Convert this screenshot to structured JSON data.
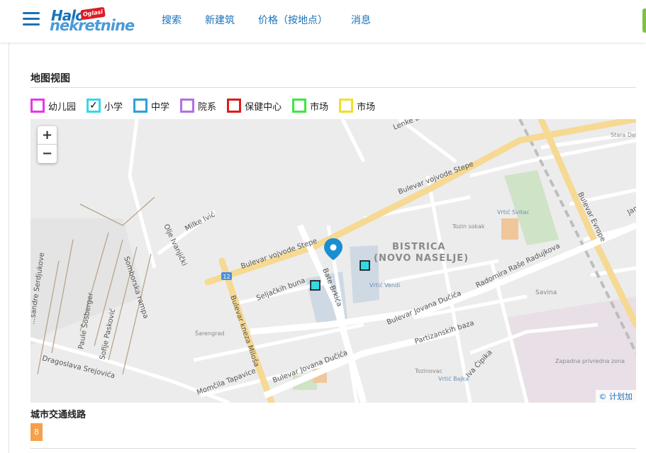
{
  "header": {
    "logo_top": "Halo",
    "logo_badge": "Oglasi",
    "logo_bottom": "nekretnine",
    "nav": [
      "搜索",
      "新建筑",
      "价格（按地点）",
      "消息"
    ]
  },
  "map_section": {
    "title": "地图视图",
    "legend": [
      {
        "label": "幼儿园",
        "color": "#e837e8",
        "checked": false
      },
      {
        "label": "小学",
        "color": "#35d9e5",
        "checked": true
      },
      {
        "label": "中学",
        "color": "#2aa3d9",
        "checked": false
      },
      {
        "label": "院系",
        "color": "#b56ee6",
        "checked": false
      },
      {
        "label": "保健中心",
        "color": "#e01b1b",
        "checked": false
      },
      {
        "label": "市场",
        "color": "#3ce83c",
        "checked": false
      },
      {
        "label": "市场",
        "color": "#f0e02a",
        "checked": false
      }
    ],
    "zoom_in": "+",
    "zoom_out": "−",
    "attribution": "© 计划加",
    "map_labels": {
      "bulevar_vojvode_stepe_1": "Bulevar vojvode Stepe",
      "bulevar_vojvode_stepe_2": "Bulevar vojvode Stepe",
      "lenke": "Lenke D...",
      "bulevar_evrope": "Bulevar Evrope",
      "stara_detelinara": "Stara Detelinara",
      "milke_ivic": "Milke Ivić",
      "olje_ivanjicki": "Olje Ivanjički",
      "somborska_rampa": "Somborska rampa",
      "aleksandre": "...sandre Serdjukove",
      "paule": "Paule Šosberger",
      "sofije": "Sofije Pasković",
      "dragoslava": "Dragoslava Srejovića",
      "bistrica": "BISTRICA",
      "novo_naselje": "(NOVO NASELJE)",
      "tozin_sokak": "Tozin sokak",
      "vrtic_svitac": "Vrtić Svitac",
      "seljackih_buna": "Seljačkih buna",
      "bate_brkica": "Bate Brkića",
      "vrtic_vendi": "Vrtić Vendi",
      "bulevar_jovana_ducica_1": "Bulevar Jovana Dučića",
      "radomira": "Radomira Raše Radujkova",
      "savina": "Savina",
      "bulevar_kneza_milosa": "Bulevar kneza Miloša",
      "sarengrad": "Šarengrad",
      "partizanskih_baza": "Partizanskih baza",
      "bulevar_jovana_ducica_2": "Bulevar Jovana Dučića",
      "momcila": "Momčila Tapavice",
      "tozinovac": "Tozinovac",
      "vrtic_bajka": "Vrtić Bajka",
      "iva_cipika": "Iva Ćipika",
      "zapadna": "Zapadna privredna zona",
      "route_12": "12",
      "jama": "Jama"
    }
  },
  "transit": {
    "title": "城市交通线路",
    "lines": [
      "8"
    ]
  },
  "colors": {
    "brand": "#1a72b8",
    "road_major": "#f6d992",
    "map_bg": "#ececec",
    "transit_badge": "#f5a04a"
  }
}
